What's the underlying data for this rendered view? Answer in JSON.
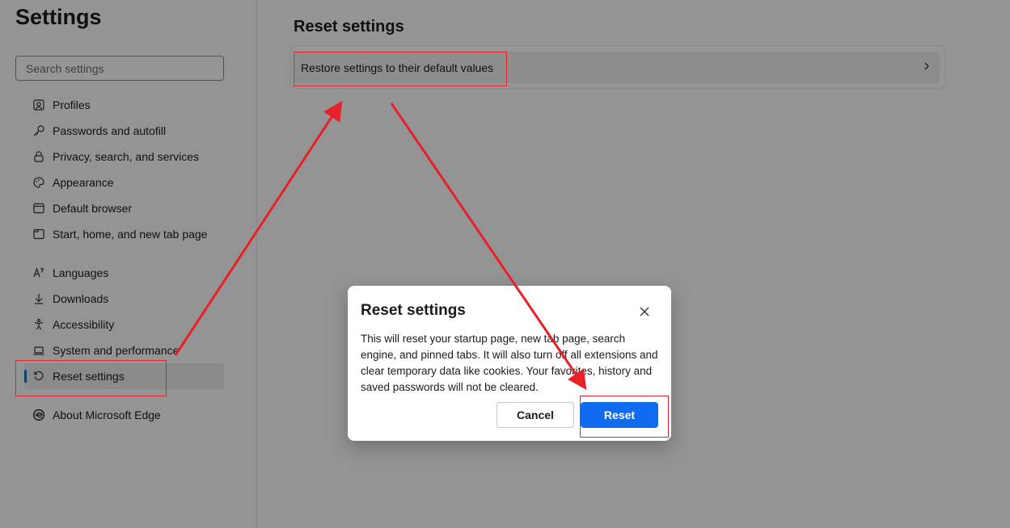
{
  "sidebar": {
    "title": "Settings",
    "search_placeholder": "Search settings",
    "items": [
      {
        "label": "Profiles",
        "icon": "profile-icon"
      },
      {
        "label": "Passwords and autofill",
        "icon": "key-icon"
      },
      {
        "label": "Privacy, search, and services",
        "icon": "lock-icon"
      },
      {
        "label": "Appearance",
        "icon": "palette-icon"
      },
      {
        "label": "Default browser",
        "icon": "browser-icon"
      },
      {
        "label": "Start, home, and new tab page",
        "icon": "home-tab-icon"
      },
      {
        "label": "Languages",
        "icon": "languages-icon"
      },
      {
        "label": "Downloads",
        "icon": "download-icon"
      },
      {
        "label": "Accessibility",
        "icon": "accessibility-icon"
      },
      {
        "label": "System and performance",
        "icon": "laptop-icon"
      },
      {
        "label": "Reset settings",
        "icon": "reset-icon",
        "active": true
      },
      {
        "label": "About Microsoft Edge",
        "icon": "edge-logo-icon"
      }
    ]
  },
  "main": {
    "title": "Reset settings",
    "row_label": "Restore settings to their default values"
  },
  "dialog": {
    "title": "Reset settings",
    "body": "This will reset your startup page, new tab page, search engine, and pinned tabs. It will also turn off all extensions and clear temporary data like cookies. Your favorites, history and saved passwords will not be cleared.",
    "cancel_label": "Cancel",
    "reset_label": "Reset"
  },
  "colors": {
    "accent": "#0f6cf0",
    "annotation": "#e8202a"
  }
}
